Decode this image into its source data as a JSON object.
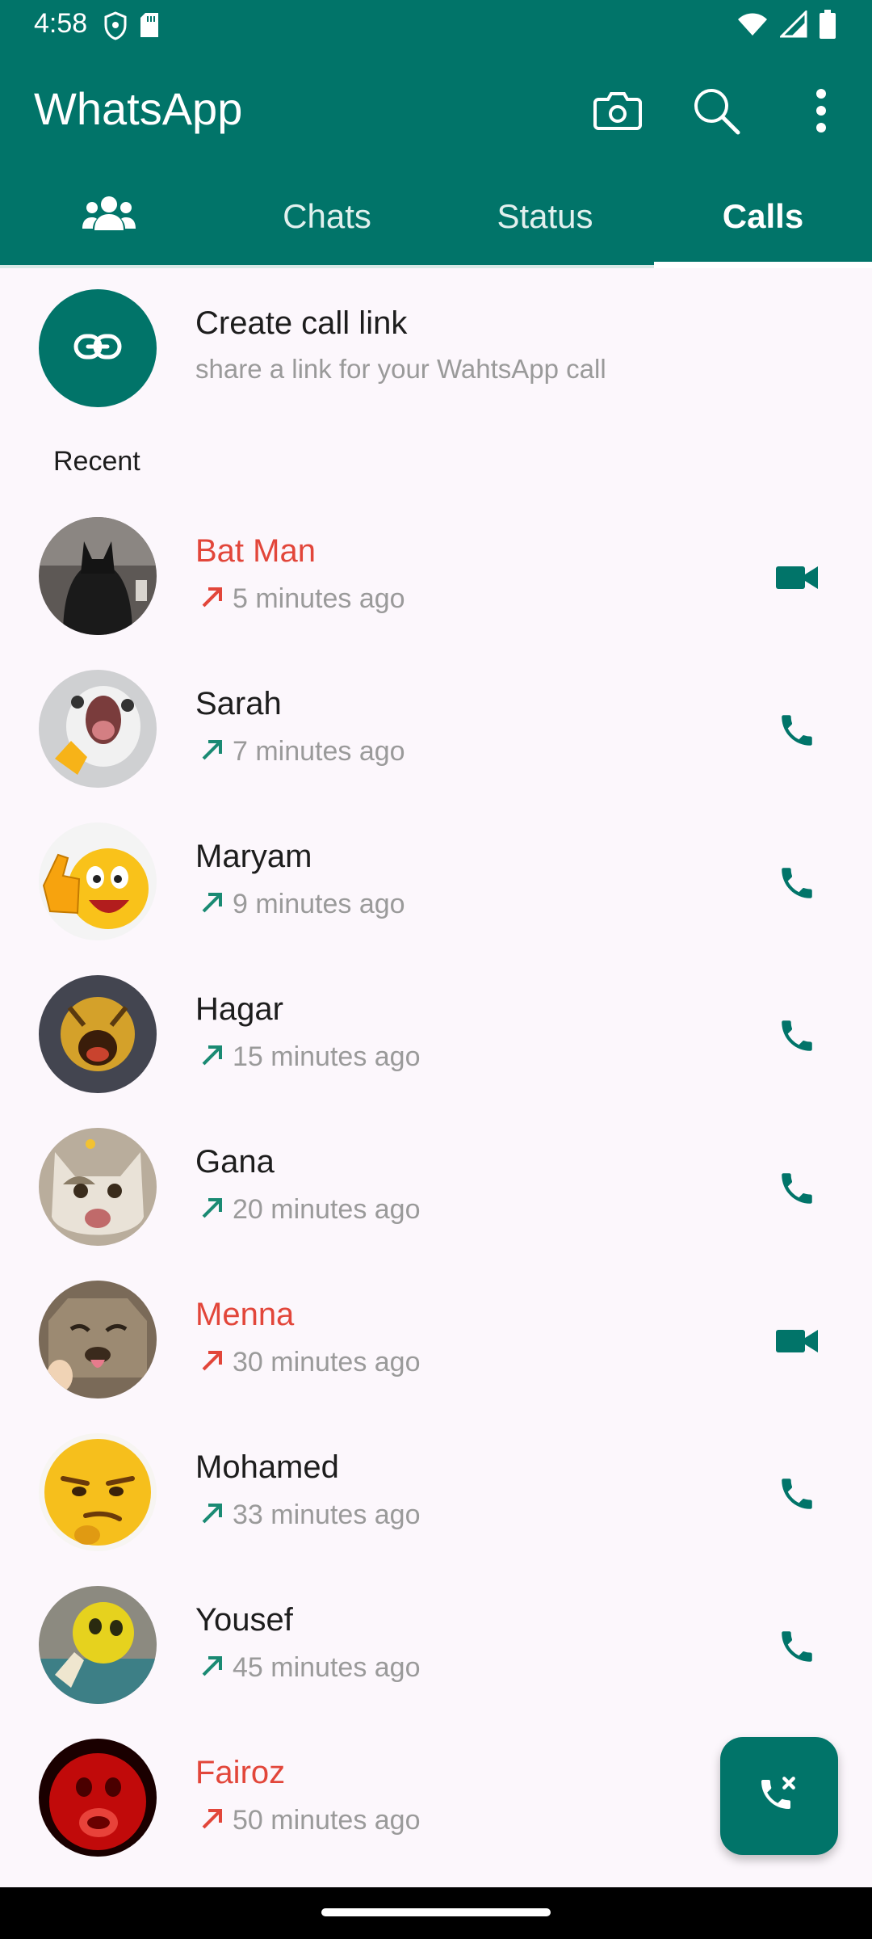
{
  "status_bar": {
    "time": "4:58"
  },
  "app_bar": {
    "title": "WhatsApp",
    "actions": [
      "camera-icon",
      "search-icon",
      "more-vert-icon"
    ]
  },
  "tabs": [
    {
      "icon": "community-icon",
      "label": ""
    },
    {
      "label": "Chats"
    },
    {
      "label": "Status"
    },
    {
      "label": "Calls",
      "active": true
    }
  ],
  "create_link": {
    "icon": "link-icon",
    "title": "Create call link",
    "subtitle": "share a link for your WahtsApp call"
  },
  "recent_label": "Recent",
  "calls": [
    {
      "name": "Bat Man",
      "time": "5 minutes ago",
      "missed": true,
      "type": "video"
    },
    {
      "name": "Sarah",
      "time": "7 minutes ago",
      "missed": false,
      "type": "voice"
    },
    {
      "name": "Maryam",
      "time": "9 minutes ago",
      "missed": false,
      "type": "voice"
    },
    {
      "name": "Hagar",
      "time": "15 minutes ago",
      "missed": false,
      "type": "voice"
    },
    {
      "name": "Gana",
      "time": "20 minutes ago",
      "missed": false,
      "type": "voice"
    },
    {
      "name": "Menna",
      "time": "30 minutes ago",
      "missed": true,
      "type": "video"
    },
    {
      "name": "Mohamed",
      "time": "33 minutes ago",
      "missed": false,
      "type": "voice"
    },
    {
      "name": "Yousef",
      "time": "45 minutes ago",
      "missed": false,
      "type": "voice"
    },
    {
      "name": "Fairoz",
      "time": "50 minutes ago",
      "missed": true,
      "type": "voice"
    }
  ],
  "colors": {
    "brand": "#017469",
    "missed": "#e2463a",
    "outgoing": "#1a8a73"
  }
}
